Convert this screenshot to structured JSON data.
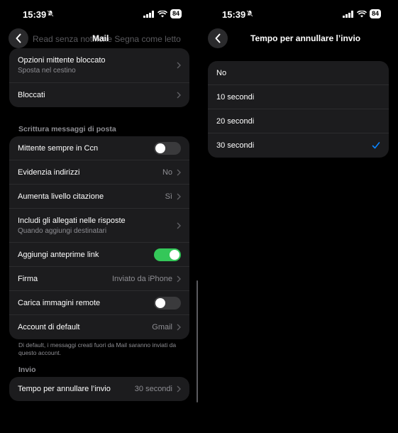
{
  "status": {
    "time": "15:39",
    "battery": "84"
  },
  "left": {
    "nav": {
      "title": "Mail",
      "ghost_text": "Read senza notifiche   Segna come letto"
    },
    "group1": [
      {
        "label": "Opzioni mittente bloccato",
        "sub": "Sposta nel cestino"
      },
      {
        "label": "Bloccati"
      }
    ],
    "section_compose": "Scrittura messaggi di posta",
    "group2": [
      {
        "label": "Mittente sempre in Ccn",
        "toggle": "off"
      },
      {
        "label": "Evidenzia indirizzi",
        "value": "No"
      },
      {
        "label": "Aumenta livello citazione",
        "value": "Sì"
      },
      {
        "label": "Includi gli allegati nelle risposte",
        "sub": "Quando aggiungi destinatari"
      },
      {
        "label": "Aggiungi anteprime link",
        "toggle": "on"
      },
      {
        "label": "Firma",
        "value": "Inviato da iPhone"
      },
      {
        "label": "Carica immagini remote",
        "toggle": "off"
      },
      {
        "label": "Account di default",
        "value": "Gmail"
      }
    ],
    "footnote": "Di default, i messaggi creati fuori da Mail saranno inviati da questo account.",
    "section_send": "Invio",
    "group3": [
      {
        "label": "Tempo per annullare l’invio",
        "value": "30 secondi"
      }
    ]
  },
  "right": {
    "nav": {
      "title": "Tempo per annullare l’invio"
    },
    "options": [
      "No",
      "10 secondi",
      "20 secondi",
      "30 secondi"
    ],
    "selected_index": 3,
    "accent": "#0a84ff"
  }
}
